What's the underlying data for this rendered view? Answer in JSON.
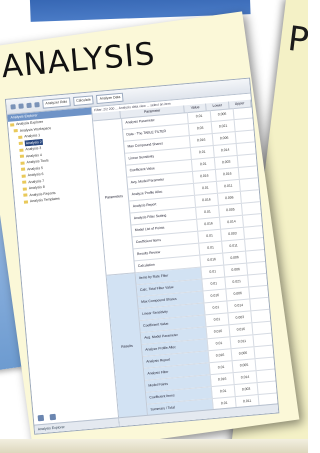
{
  "title": "ANALYSIS",
  "right_card_letter": "P",
  "toolbar": {
    "combos": [
      "Analyzer Rdts",
      "Calculate",
      "Analyze Data"
    ]
  },
  "explorer": {
    "header": "Analysis Explorer",
    "items": [
      {
        "label": "Analysis Explorer",
        "selected": false
      },
      {
        "label": "Analysis Workspace",
        "selected": false
      },
      {
        "label": "Analysis 1",
        "selected": false
      },
      {
        "label": "Analysis 2",
        "selected": true
      },
      {
        "label": "Analysis 3",
        "selected": false
      },
      {
        "label": "Analysis 4",
        "selected": false
      },
      {
        "label": "Analysis Tools",
        "selected": false
      },
      {
        "label": "Analysis 5",
        "selected": false
      },
      {
        "label": "Analysis 6",
        "selected": false
      },
      {
        "label": "Analysis 7",
        "selected": false
      },
      {
        "label": "Analysis 8",
        "selected": false
      },
      {
        "label": "Analysis Reports",
        "selected": false
      },
      {
        "label": "Analysis Templates",
        "selected": false
      }
    ],
    "footer": "Analysis Explorer"
  },
  "main": {
    "info_text": "Filter: 2/2 200 ... Analysis data view ... select an item",
    "columns": [
      "",
      "Parameter",
      "Value",
      "Lower",
      "Upper"
    ],
    "groups": [
      {
        "label": "Parameters",
        "style": "plain",
        "rows": [
          {
            "name": "Analysis Parameter",
            "v": [
              "0.01",
              "0.006"
            ],
            "selected": true
          },
          {
            "name": "Data - The TABLE FILTER",
            "v": [
              "0.03",
              "0.021"
            ]
          },
          {
            "name": "Max Compound Shares",
            "v": [
              "0.016",
              "0.006"
            ]
          },
          {
            "name": "Linear Sensitivity",
            "v": [
              "0.01",
              "0.014"
            ]
          },
          {
            "name": "Coefficient Value",
            "v": [
              "0.01",
              "0.003"
            ]
          },
          {
            "name": "Avg. Model Parameter",
            "v": [
              "0.016",
              "0.016"
            ]
          },
          {
            "name": "Analyze Profile Alloc",
            "v": [
              "0.01",
              "0.011"
            ]
          },
          {
            "name": "Analysis Report",
            "v": [
              "0.016",
              "0.006"
            ]
          },
          {
            "name": "Analysis Filter Setting",
            "v": [
              "0.01",
              "0.005"
            ]
          },
          {
            "name": "Model List of Points",
            "v": [
              "0.016",
              "0.014"
            ]
          },
          {
            "name": "Coefficient Items",
            "v": [
              "0.01",
              "0.003"
            ]
          },
          {
            "name": "Results Review",
            "v": [
              "0.01",
              "0.011"
            ]
          },
          {
            "name": "Calculation",
            "v": [
              "0.016",
              "0.006"
            ]
          }
        ]
      },
      {
        "label": "Results",
        "style": "blue",
        "rows": [
          {
            "name": "Items by Rate Filter",
            "v": [
              "0.01",
              "0.006"
            ]
          },
          {
            "name": "Calc. Total Filter Value",
            "v": [
              "0.01",
              "0.021"
            ]
          },
          {
            "name": "Max Compound Shares",
            "v": [
              "0.016",
              "0.006"
            ]
          },
          {
            "name": "Linear Sensitivity",
            "v": [
              "0.01",
              "0.014"
            ]
          },
          {
            "name": "Coefficient Value",
            "v": [
              "0.01",
              "0.003"
            ]
          },
          {
            "name": "Avg. Model Parameter",
            "v": [
              "0.016",
              "0.016"
            ]
          },
          {
            "name": "Analyze Profile Alloc",
            "v": [
              "0.01",
              "0.011"
            ]
          },
          {
            "name": "Analysis Report",
            "v": [
              "0.016",
              "0.006"
            ]
          },
          {
            "name": "Analysis Filter",
            "v": [
              "0.01",
              "0.005"
            ]
          },
          {
            "name": "Model Points",
            "v": [
              "0.016",
              "0.014"
            ]
          },
          {
            "name": "Coefficient Items",
            "v": [
              "0.01",
              "0.003"
            ]
          },
          {
            "name": "Summary / Total",
            "v": [
              "0.01",
              "0.011"
            ]
          }
        ]
      }
    ]
  },
  "colors": {
    "card": "#fbf8d8",
    "accent": "#27467e",
    "results_band": "#d2e2f3",
    "left_card": "#8cb1de"
  }
}
